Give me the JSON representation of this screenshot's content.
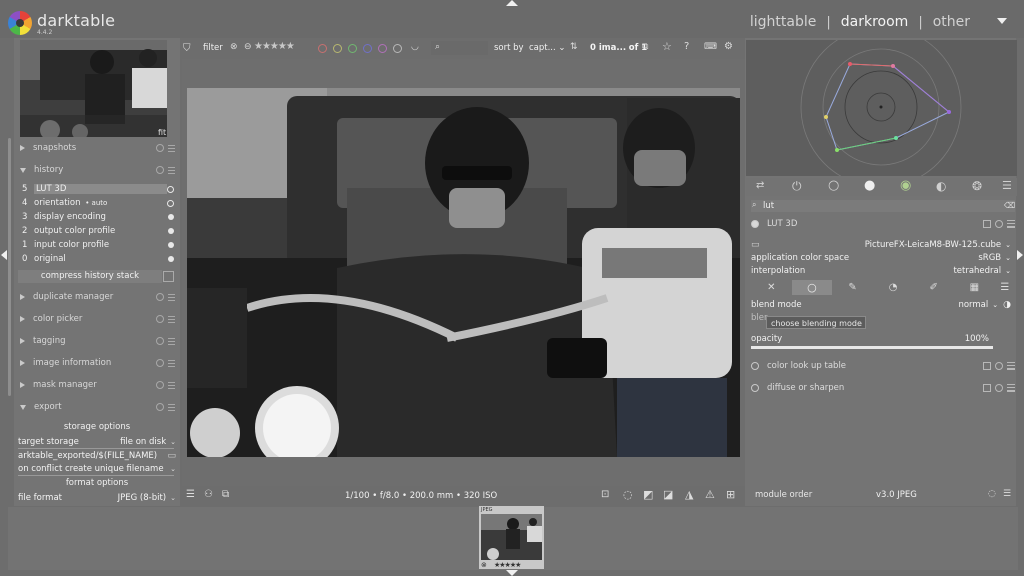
{
  "header": {
    "app_name": "darktable",
    "version": "4.4.2",
    "views": [
      "lighttable",
      "darkroom",
      "other"
    ],
    "active_view": "darkroom"
  },
  "navigation": {
    "zoom": "fit"
  },
  "left_modules": {
    "snapshots": "snapshots",
    "history": "history",
    "history_items": [
      {
        "num": "5",
        "name": "LUT 3D",
        "extra": ""
      },
      {
        "num": "4",
        "name": "orientation",
        "extra": "• auto"
      },
      {
        "num": "3",
        "name": "display encoding",
        "extra": ""
      },
      {
        "num": "2",
        "name": "output color profile",
        "extra": ""
      },
      {
        "num": "1",
        "name": "input color profile",
        "extra": ""
      },
      {
        "num": "0",
        "name": "original",
        "extra": ""
      }
    ],
    "compress_label": "compress history stack",
    "duplicate_manager": "duplicate manager",
    "color_picker": "color picker",
    "tagging": "tagging",
    "image_information": "image information",
    "mask_manager": "mask manager",
    "export": "export"
  },
  "export": {
    "storage_options": "storage options",
    "target_storage_label": "target storage",
    "target_storage_value": "file on disk",
    "path": "arktable_exported/$(FILE_NAME)",
    "on_conflict": "on conflict create unique filename",
    "format_options": "format options",
    "file_format_label": "file format",
    "file_format_value": "JPEG (8-bit)"
  },
  "filterbar": {
    "filter_label": "filter",
    "stars": "★★★★★",
    "sort_label": "sort by",
    "sort_value": "capt...",
    "count": "0 ima...",
    "of": "of 1"
  },
  "bottombar": {
    "exif": "1/100 • f/8.0 • 200.0 mm • 320 ISO"
  },
  "right_panel": {
    "search_value": "lut",
    "lut3d_title": "LUT 3D",
    "lut_file": "PictureFX-LeicaM8-BW-125.cube",
    "app_color_space_label": "application color space",
    "app_color_space_value": "sRGB",
    "interpolation_label": "interpolation",
    "interpolation_value": "tetrahedral",
    "blend_mode_label": "blend mode",
    "blend_mode_value": "normal",
    "blend_partial": "bler",
    "tooltip": "choose blending mode",
    "opacity_label": "opacity",
    "opacity_value": "100%",
    "opacity_fraction": 1.0,
    "color_lut": "color look up table",
    "diffuse": "diffuse or sharpen",
    "module_order_label": "module order",
    "module_order_value": "v3.0 JPEG"
  },
  "filmstrip": {
    "thumb_ext": "JPEG",
    "thumb_stars": "★★★★★"
  }
}
